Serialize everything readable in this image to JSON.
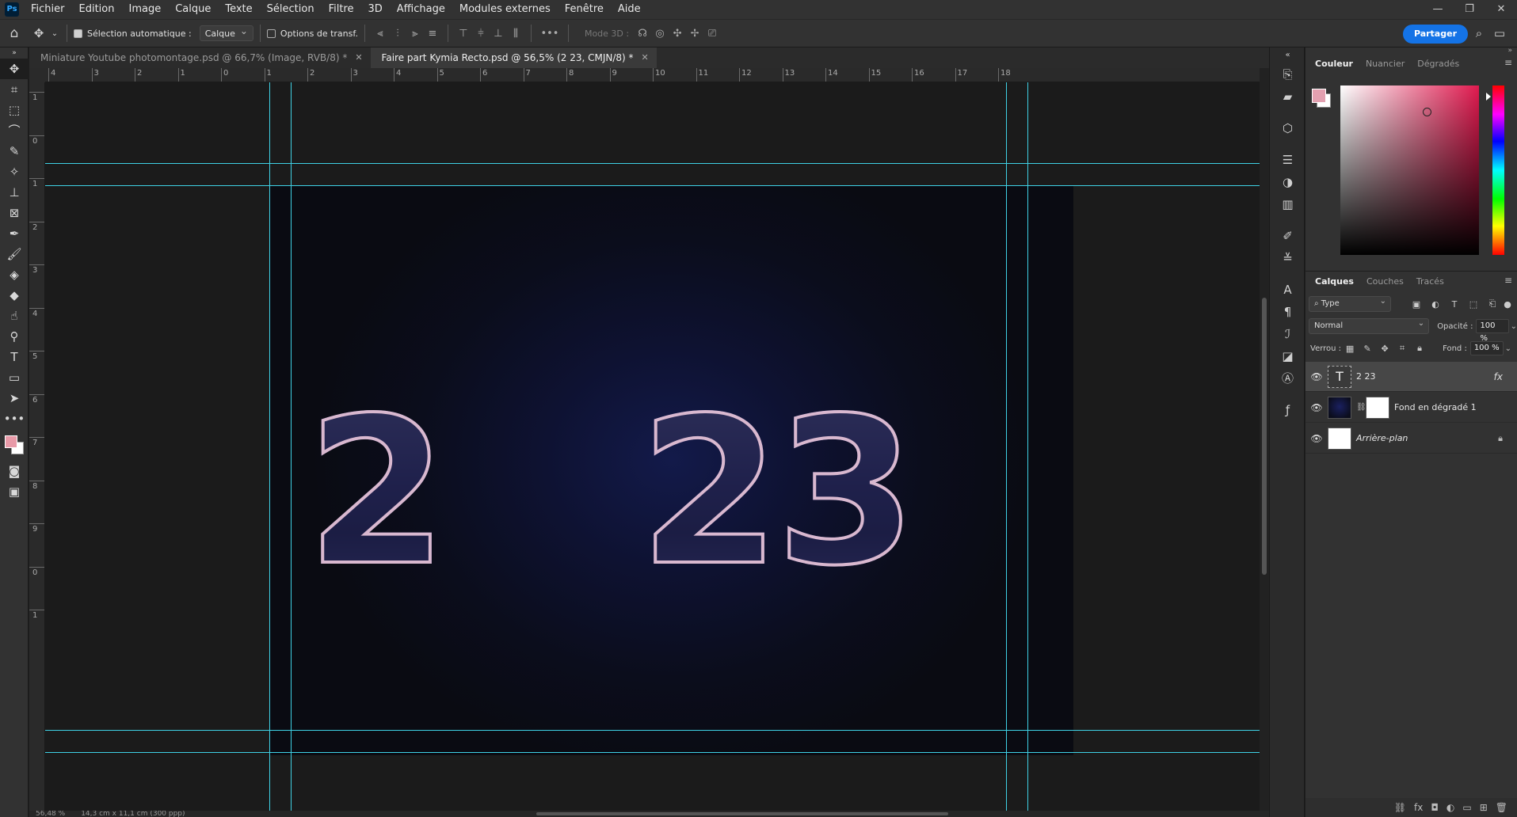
{
  "app": {
    "logo": "Ps",
    "menu": [
      "Fichier",
      "Edition",
      "Image",
      "Calque",
      "Texte",
      "Sélection",
      "Filtre",
      "3D",
      "Affichage",
      "Modules externes",
      "Fenêtre",
      "Aide"
    ],
    "window_controls": [
      "—",
      "❐",
      "✕"
    ]
  },
  "options_bar": {
    "auto_select_label": "Sélection automatique :",
    "auto_select_checked": true,
    "auto_select_target": "Calque",
    "transform_label": "Options de transf.",
    "transform_checked": false,
    "mode3d_label": "Mode 3D :",
    "share_label": "Partager",
    "more": "•••"
  },
  "tabs": [
    {
      "title": "Miniature Youtube photomontage.psd @ 66,7% (Image, RVB/8) *",
      "active": false
    },
    {
      "title": "Faire part Kymia Recto.psd @ 56,5% (2     23, CMJN/8) *",
      "active": true
    }
  ],
  "rulers": {
    "top_labels": [
      "4",
      "3",
      "2",
      "1",
      "0",
      "1",
      "2",
      "3",
      "4",
      "5",
      "6",
      "7",
      "8",
      "9",
      "10",
      "11",
      "12",
      "13",
      "14",
      "15",
      "16",
      "17",
      "18"
    ],
    "left_labels": [
      "1",
      "0",
      "1",
      "2",
      "3",
      "4",
      "5",
      "6",
      "7",
      "8",
      "9",
      "0",
      "1"
    ]
  },
  "canvas": {
    "text_left": "2",
    "text_right": "23",
    "colors": {
      "guide": "#3fd2e6",
      "digit_fill": "#3f4298",
      "digit_stroke": "#d9b8cf",
      "background_center": "#131a4a"
    }
  },
  "status": {
    "zoom": "56,48 %",
    "doc_size": "14,3 cm x 11,1 cm (300 ppp)"
  },
  "color_panel": {
    "tabs": [
      "Couleur",
      "Nuancier",
      "Dégradés"
    ],
    "foreground": "#e3a0b0",
    "background": "#ffffff"
  },
  "layers_panel": {
    "tabs": [
      "Calques",
      "Couches",
      "Tracés"
    ],
    "filter_type": "Type",
    "blend_mode": "Normal",
    "opacity_label": "Opacité :",
    "opacity_value": "100 %",
    "lock_label": "Verrou :",
    "fill_label": "Fond :",
    "fill_value": "100 %",
    "layers": [
      {
        "name": "2       23",
        "kind": "text",
        "selected": true,
        "fx": "fx"
      },
      {
        "name": "Fond en dégradé 1",
        "kind": "gradient",
        "selected": false
      },
      {
        "name": "Arrière-plan",
        "kind": "background",
        "selected": false,
        "locked": true
      }
    ]
  }
}
